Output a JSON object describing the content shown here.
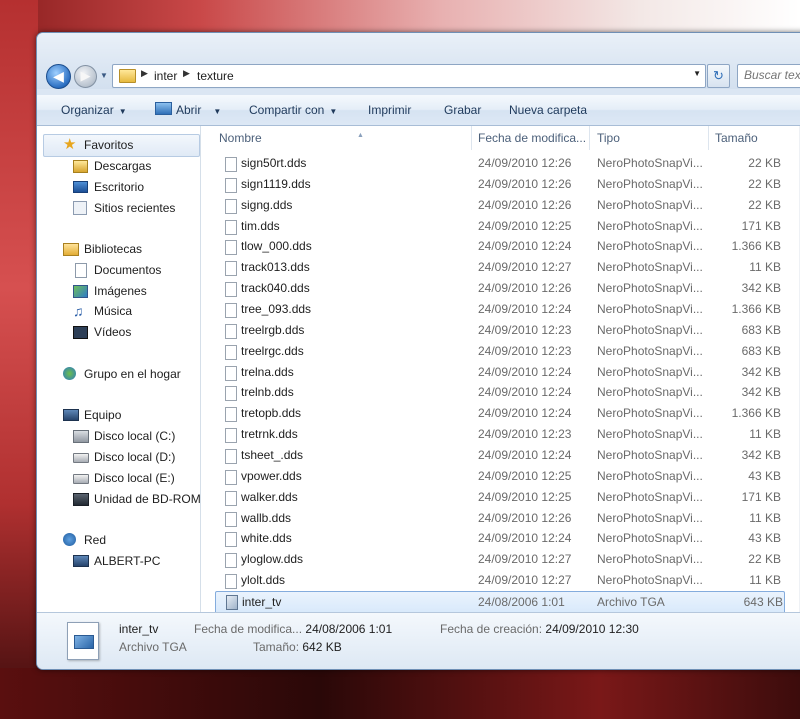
{
  "address_bar": {
    "breadcrumbs": [
      "inter",
      "texture"
    ]
  },
  "search": {
    "placeholder": "Buscar tex"
  },
  "toolbar": {
    "organize_label": "Organizar",
    "open_label": "Abrir",
    "share_label": "Compartir con",
    "print_label": "Imprimir",
    "burn_label": "Grabar",
    "new_folder_label": "Nueva carpeta"
  },
  "sidebar": {
    "favorites": {
      "label": "Favoritos",
      "items": [
        "Descargas",
        "Escritorio",
        "Sitios recientes"
      ]
    },
    "libraries": {
      "label": "Bibliotecas",
      "items": [
        "Documentos",
        "Imágenes",
        "Música",
        "Vídeos"
      ]
    },
    "homegroup": {
      "label": "Grupo en el hogar"
    },
    "computer": {
      "label": "Equipo",
      "items": [
        "Disco local (C:)",
        "Disco local (D:)",
        "Disco local (E:)",
        "Unidad de BD-ROM"
      ]
    },
    "network": {
      "label": "Red",
      "items": [
        "ALBERT-PC"
      ]
    }
  },
  "columns": {
    "name": "Nombre",
    "date": "Fecha de modifica...",
    "type": "Tipo",
    "size": "Tamaño"
  },
  "files": [
    {
      "name": "sign50rt.dds",
      "date": "24/09/2010 12:26",
      "type": "NeroPhotoSnapVi...",
      "size": "22 KB"
    },
    {
      "name": "sign1119.dds",
      "date": "24/09/2010 12:26",
      "type": "NeroPhotoSnapVi...",
      "size": "22 KB"
    },
    {
      "name": "signg.dds",
      "date": "24/09/2010 12:26",
      "type": "NeroPhotoSnapVi...",
      "size": "22 KB"
    },
    {
      "name": "tim.dds",
      "date": "24/09/2010 12:25",
      "type": "NeroPhotoSnapVi...",
      "size": "171 KB"
    },
    {
      "name": "tlow_000.dds",
      "date": "24/09/2010 12:24",
      "type": "NeroPhotoSnapVi...",
      "size": "1.366 KB"
    },
    {
      "name": "track013.dds",
      "date": "24/09/2010 12:27",
      "type": "NeroPhotoSnapVi...",
      "size": "11 KB"
    },
    {
      "name": "track040.dds",
      "date": "24/09/2010 12:26",
      "type": "NeroPhotoSnapVi...",
      "size": "342 KB"
    },
    {
      "name": "tree_093.dds",
      "date": "24/09/2010 12:24",
      "type": "NeroPhotoSnapVi...",
      "size": "1.366 KB"
    },
    {
      "name": "treelrgb.dds",
      "date": "24/09/2010 12:23",
      "type": "NeroPhotoSnapVi...",
      "size": "683 KB"
    },
    {
      "name": "treelrgc.dds",
      "date": "24/09/2010 12:23",
      "type": "NeroPhotoSnapVi...",
      "size": "683 KB"
    },
    {
      "name": "trelna.dds",
      "date": "24/09/2010 12:24",
      "type": "NeroPhotoSnapVi...",
      "size": "342 KB"
    },
    {
      "name": "trelnb.dds",
      "date": "24/09/2010 12:24",
      "type": "NeroPhotoSnapVi...",
      "size": "342 KB"
    },
    {
      "name": "tretopb.dds",
      "date": "24/09/2010 12:24",
      "type": "NeroPhotoSnapVi...",
      "size": "1.366 KB"
    },
    {
      "name": "tretrnk.dds",
      "date": "24/09/2010 12:23",
      "type": "NeroPhotoSnapVi...",
      "size": "11 KB"
    },
    {
      "name": "tsheet_.dds",
      "date": "24/09/2010 12:24",
      "type": "NeroPhotoSnapVi...",
      "size": "342 KB"
    },
    {
      "name": "vpower.dds",
      "date": "24/09/2010 12:25",
      "type": "NeroPhotoSnapVi...",
      "size": "43 KB"
    },
    {
      "name": "walker.dds",
      "date": "24/09/2010 12:25",
      "type": "NeroPhotoSnapVi...",
      "size": "171 KB"
    },
    {
      "name": "wallb.dds",
      "date": "24/09/2010 12:26",
      "type": "NeroPhotoSnapVi...",
      "size": "11 KB"
    },
    {
      "name": "white.dds",
      "date": "24/09/2010 12:24",
      "type": "NeroPhotoSnapVi...",
      "size": "43 KB"
    },
    {
      "name": "yloglow.dds",
      "date": "24/09/2010 12:27",
      "type": "NeroPhotoSnapVi...",
      "size": "22 KB"
    },
    {
      "name": "ylolt.dds",
      "date": "24/09/2010 12:27",
      "type": "NeroPhotoSnapVi...",
      "size": "11 KB"
    },
    {
      "name": "inter_tv",
      "date": "24/08/2006 1:01",
      "type": "Archivo TGA",
      "size": "643 KB",
      "selected": true
    }
  ],
  "details": {
    "name": "inter_tv",
    "type": "Archivo TGA",
    "modified_label": "Fecha de modifica...",
    "modified_value": "24/08/2006 1:01",
    "created_label": "Fecha de creación:",
    "created_value": "24/09/2010 12:30",
    "size_label": "Tamaño:",
    "size_value": "642 KB"
  },
  "icons": {
    "back": "back-arrow-icon",
    "forward": "forward-arrow-icon",
    "refresh": "refresh-icon",
    "favorites": "star-icon",
    "file": "dds-file-icon",
    "tga": "tga-file-icon"
  },
  "colors": {
    "selection_border": "#84acdd",
    "toolbar_text": "#1e395b",
    "header_text": "#4c607a"
  }
}
